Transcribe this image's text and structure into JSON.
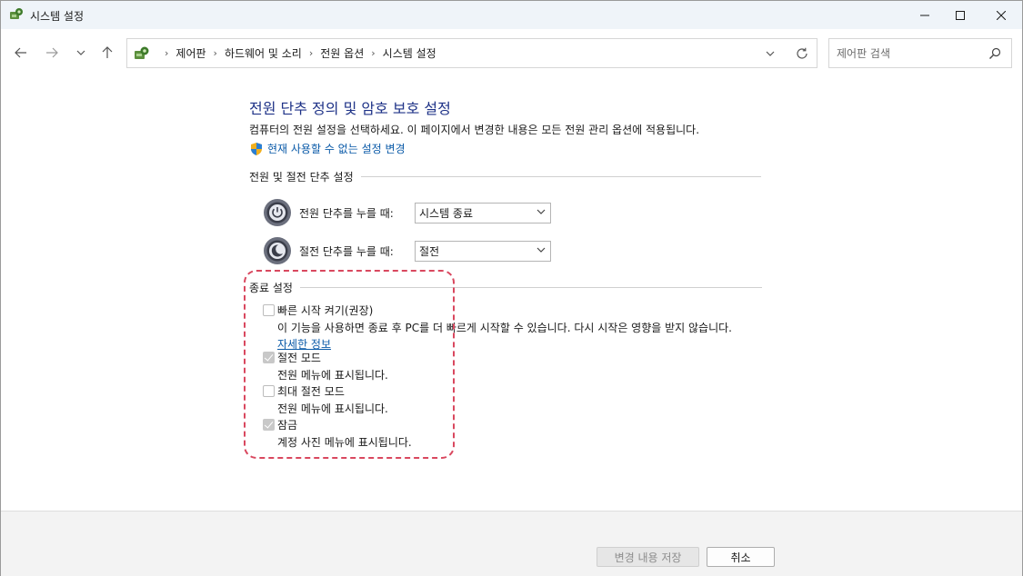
{
  "window": {
    "title": "시스템 설정"
  },
  "nav": {
    "breadcrumbs": [
      "제어판",
      "하드웨어 및 소리",
      "전원 옵션",
      "시스템 설정"
    ],
    "search_placeholder": "제어판 검색"
  },
  "main": {
    "title": "전원 단추 정의 및 암호 보호 설정",
    "description": "컴퓨터의 전원 설정을 선택하세요. 이 페이지에서 변경한 내용은 모든 전원 관리 옵션에 적용됩니다.",
    "change_link": "현재 사용할 수 없는 설정 변경",
    "power_section": {
      "header": "전원 및 절전 단추 설정",
      "rows": [
        {
          "label": "전원 단추를 누를 때:",
          "value": "시스템 종료"
        },
        {
          "label": "절전 단추를 누를 때:",
          "value": "절전"
        }
      ]
    },
    "shutdown_section": {
      "header": "종료 설정",
      "options": [
        {
          "label": "빠른 시작 켜기(권장)",
          "desc": "이 기능을 사용하면 종료 후 PC를 더 빠르게 시작할 수 있습니다. 다시 시작은 영향을 받지 않습니다.",
          "link": "자세한 정보",
          "checked": false
        },
        {
          "label": "절전 모드",
          "desc": "전원 메뉴에 표시됩니다.",
          "checked": true
        },
        {
          "label": "최대 절전 모드",
          "desc": "전원 메뉴에 표시됩니다.",
          "checked": false
        },
        {
          "label": "잠금",
          "desc": "계정 사진 메뉴에 표시됩니다.",
          "checked": true
        }
      ]
    }
  },
  "footer": {
    "save_label": "변경 내용 저장",
    "cancel_label": "취소"
  },
  "colors": {
    "title_blue": "#1e3287",
    "link_blue": "#0a5aa8",
    "highlight": "#d9485f"
  }
}
